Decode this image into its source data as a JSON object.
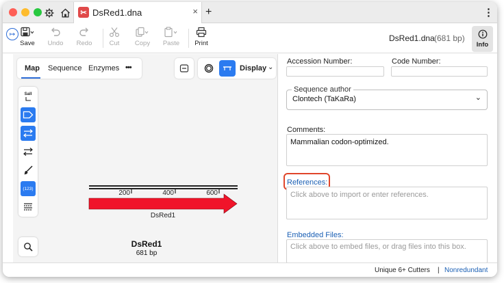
{
  "titlebar": {
    "tab_title": "DsRed1.dna",
    "tab_close": "×",
    "new_tab": "+",
    "menu": "⋮"
  },
  "toolbar": {
    "save": "Save",
    "undo": "Undo",
    "redo": "Redo",
    "cut": "Cut",
    "copy": "Copy",
    "paste": "Paste",
    "print": "Print",
    "doc_name": "DsRed1.dna",
    "doc_size": "(681 bp)",
    "info": "Info"
  },
  "map_tabs": {
    "map": "Map",
    "sequence": "Sequence",
    "enzymes": "Enzymes",
    "more": "•••"
  },
  "display_button": "Display",
  "tool_strip": {
    "enzyme_label": "SalI",
    "numbers_label": "(123)"
  },
  "map": {
    "ticks": [
      "200",
      "400",
      "600"
    ],
    "feature_label": "DsRed1",
    "sequence_name": "DsRed1",
    "sequence_length": "681 bp",
    "feature_color": "#f0142a"
  },
  "info_panel": {
    "accession_label": "Accession Number:",
    "code_label": "Code Number:",
    "sequence_author_legend": "Sequence author",
    "sequence_author_value": "Clontech (TaKaRa)",
    "comments_label": "Comments:",
    "comments_value": "Mammalian codon-optimized.",
    "references_label": "References:",
    "references_placeholder": "Click above to import or enter references.",
    "embedded_label": "Embedded Files:",
    "embedded_placeholder": "Click above to embed files, or drag files into this box."
  },
  "statusbar": {
    "cutters": "Unique 6+ Cutters",
    "divider": "|",
    "mode": "Nonredundant"
  },
  "colors": {
    "accent": "#2b7bf0",
    "link": "#1a5fb4",
    "highlight": "#e0452a"
  }
}
